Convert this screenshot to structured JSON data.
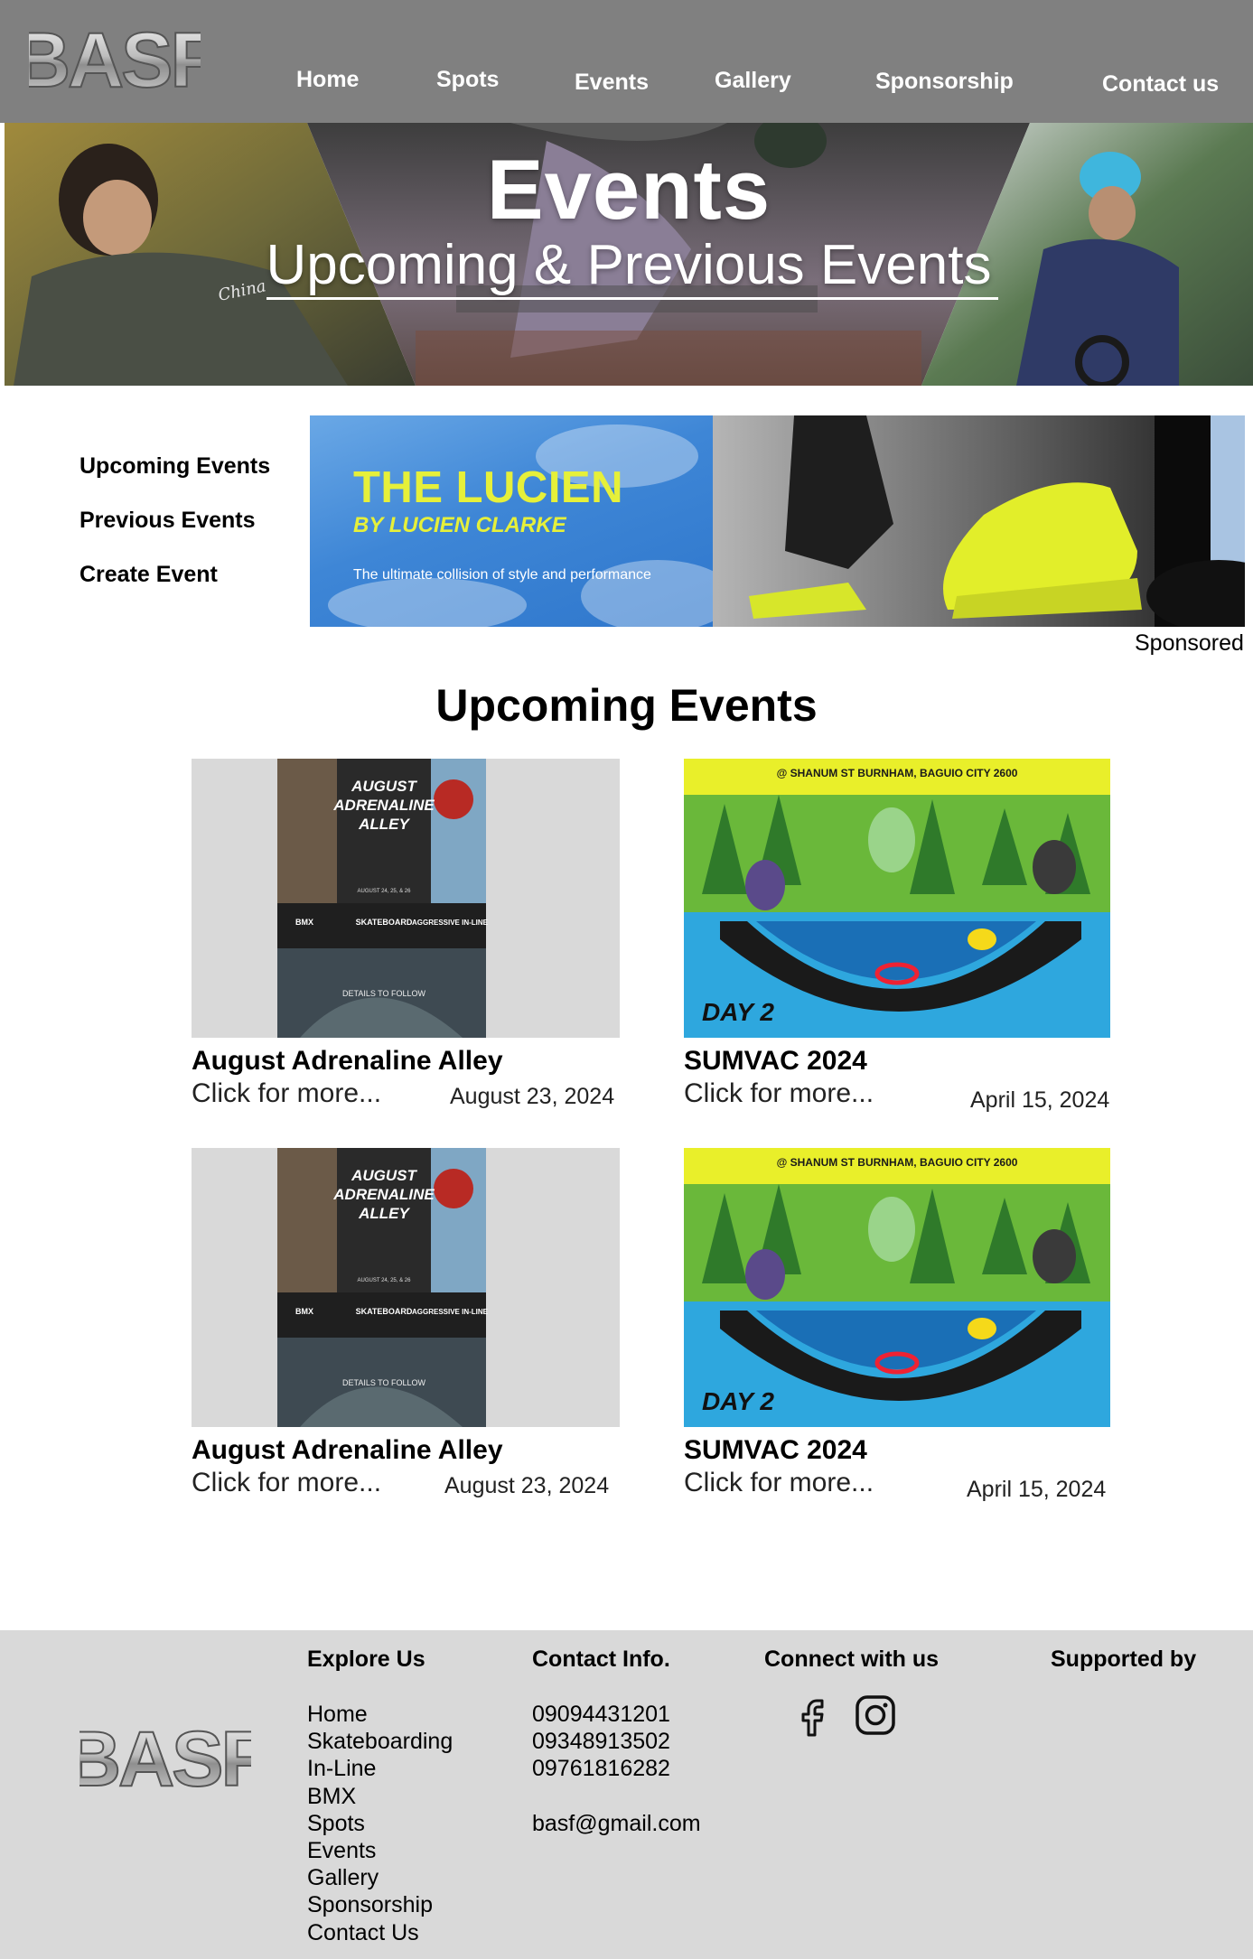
{
  "brand": {
    "logo_text": "BASF"
  },
  "nav": {
    "home": "Home",
    "spots": "Spots",
    "events": "Events",
    "gallery": "Gallery",
    "sponsorship": "Sponsorship",
    "contact": "Contact us"
  },
  "hero": {
    "title": "Events",
    "subtitle": "Upcoming & Previous Events"
  },
  "side_menu": {
    "upcoming": "Upcoming Events",
    "previous": "Previous Events",
    "create": "Create Event"
  },
  "sponsor_banner": {
    "headline": "THE LUCIEN",
    "byline": "BY LUCIEN CLARKE",
    "tagline": "The ultimate collision of style and performance",
    "sponsored_label": "Sponsored"
  },
  "upcoming": {
    "title": "Upcoming Events",
    "events": [
      {
        "name": "August Adrenaline Alley",
        "more": "Click for more...",
        "date": "August 23, 2024"
      },
      {
        "name": "SUMVAC 2024",
        "more": "Click for more...",
        "date": "April 15, 2024"
      },
      {
        "name": "August Adrenaline Alley",
        "more": "Click for more...",
        "date": "August 23, 2024"
      },
      {
        "name": "SUMVAC 2024",
        "more": "Click for more...",
        "date": "April 15, 2024"
      }
    ],
    "poster_aaa": {
      "title_1": "AUGUST",
      "title_2": "ADRENALINE",
      "title_3": "ALLEY",
      "dates": "AUGUST 24, 25, & 26",
      "disciplines": [
        "BMX",
        "SKATEBOARD",
        "AGGRESSIVE IN-LINE"
      ],
      "details": "DETAILS TO FOLLOW"
    },
    "poster_sumvac": {
      "location": "@ SHANUM ST BURNHAM, BAGUIO CITY 2600",
      "day": "DAY 2"
    }
  },
  "footer": {
    "explore": {
      "heading": "Explore Us",
      "links": [
        "Home",
        "Skateboarding",
        "In-Line",
        "BMX",
        "Spots",
        "Events",
        "Gallery",
        "Sponsorship",
        "Contact Us"
      ]
    },
    "contact": {
      "heading": "Contact Info.",
      "phones": [
        "09094431201",
        "09348913502",
        "09761816282"
      ],
      "email": "basf@gmail.com"
    },
    "connect": {
      "heading": "Connect with us",
      "icons": [
        "facebook-icon",
        "instagram-icon"
      ]
    },
    "supported": {
      "heading": "Supported by"
    }
  },
  "colors": {
    "header_bg": "#808080",
    "footer_bg": "#d9d9d9",
    "banner_yellow": "#e6f03a",
    "banner_blue": "#3e86d6"
  }
}
